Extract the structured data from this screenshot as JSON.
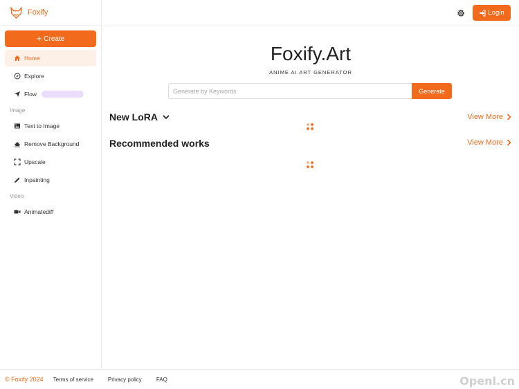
{
  "brand": {
    "name": "Foxify"
  },
  "sidebar": {
    "create_label": "Create",
    "items": [
      {
        "label": "Home",
        "icon": "home-icon"
      },
      {
        "label": "Explore",
        "icon": "compass-icon"
      },
      {
        "label": "Flow",
        "icon": "send-icon"
      }
    ],
    "image_section": "Image",
    "image_items": [
      {
        "label": "Text to Image",
        "icon": "image-icon"
      },
      {
        "label": "Remove Background",
        "icon": "eraser-icon"
      },
      {
        "label": "Upscale",
        "icon": "expand-icon"
      },
      {
        "label": "Inpainting",
        "icon": "pencil-icon"
      }
    ],
    "video_section": "Video",
    "video_items": [
      {
        "label": "Animatediff",
        "icon": "video-icon"
      }
    ]
  },
  "header": {
    "login_label": "Login"
  },
  "hero": {
    "title": "Foxify.Art",
    "subtitle": "ANIME AI ART GENERATOR",
    "search_placeholder": "Generate by Keywords",
    "search_value": "",
    "generate_label": "Generate"
  },
  "sections": {
    "new_lora": {
      "title": "New LoRA",
      "view_more": "View More"
    },
    "recommended": {
      "title": "Recommended works",
      "view_more": "View More"
    }
  },
  "footer": {
    "copyright": "© Foxify 2024",
    "links": [
      "Terms of service",
      "Privacy policy",
      "FAQ"
    ]
  },
  "colors": {
    "accent": "#f26a1b",
    "active_bg": "#fdf0e6",
    "flow_bar": "#e9ddfb"
  }
}
